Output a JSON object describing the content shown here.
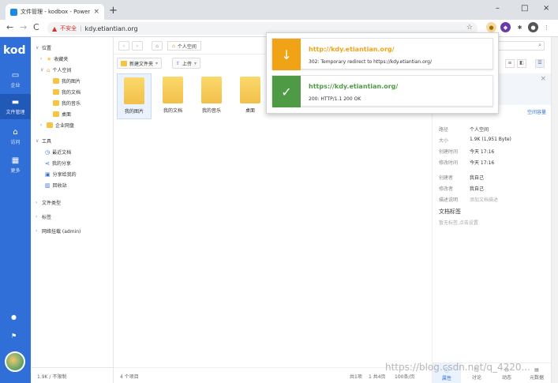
{
  "browser": {
    "tab_title": "文件管理 - kodbox - Powered b",
    "tab_close": "×",
    "new_tab": "+",
    "window_controls": [
      "–",
      "□",
      "×"
    ],
    "insecure_label": "不安全",
    "url": "kdy.etiantian.org"
  },
  "app": {
    "logo": "kod",
    "rail": [
      {
        "label": "企业",
        "icon": "monitor-icon"
      },
      {
        "label": "文件管理",
        "icon": "folder-icon"
      },
      {
        "label": "访问",
        "icon": "home-icon"
      },
      {
        "label": "更多",
        "icon": "grid-icon"
      }
    ],
    "tree": {
      "location": "位置",
      "favorites": "收藏夹",
      "personal": "个人空间",
      "children": [
        "我的图片",
        "我的文档",
        "我的音乐",
        "桌面"
      ],
      "enterprise": "企业网盘",
      "tools": "工具",
      "tool_items": [
        "最近文档",
        "我的分享",
        "分享给我的",
        "回收站"
      ],
      "file_types": "文件类型",
      "tags": "标签",
      "network": "网络挂载 (admin)",
      "quota": "1.9K / 不限制"
    },
    "main": {
      "crumb": "个人空间",
      "new_folder": "新建文件夹",
      "upload": "上传",
      "files": [
        "我的图片",
        "我的文档",
        "我的音乐",
        "桌面"
      ],
      "status_count": "4 个项目",
      "status_total": "共1项",
      "status_per": "1 共4页",
      "status_page": "100条/页"
    },
    "panel": {
      "link": "空间容量",
      "labels": [
        "路径",
        "大小",
        "创建时间",
        "修改时间",
        "创建者",
        "修改者",
        "描述说明"
      ],
      "values": [
        "个人空间",
        "1.9K (1,951 Byte)",
        "今天 17:16",
        "今天 17:16",
        "我自己",
        "我自己",
        "添加文档描述"
      ],
      "tags_title": "文档标签",
      "tags_hint": "暂无标签,点击设置",
      "tabs": [
        "属性",
        "讨论",
        "动态",
        "元数据"
      ]
    }
  },
  "popup": {
    "entries": [
      {
        "url": "http://kdy.etiantian.org/",
        "status": "302: Temporary redirect to https://kdy.etiantian.org/",
        "color": "#f0a315",
        "icon": "↓"
      },
      {
        "url": "https://kdy.etiantian.org/",
        "status": "200: HTTP/1.1 200 OK",
        "color": "#4f9a45",
        "icon": "✓"
      }
    ]
  },
  "watermark": "https://blog.csdn.net/q_4220..."
}
